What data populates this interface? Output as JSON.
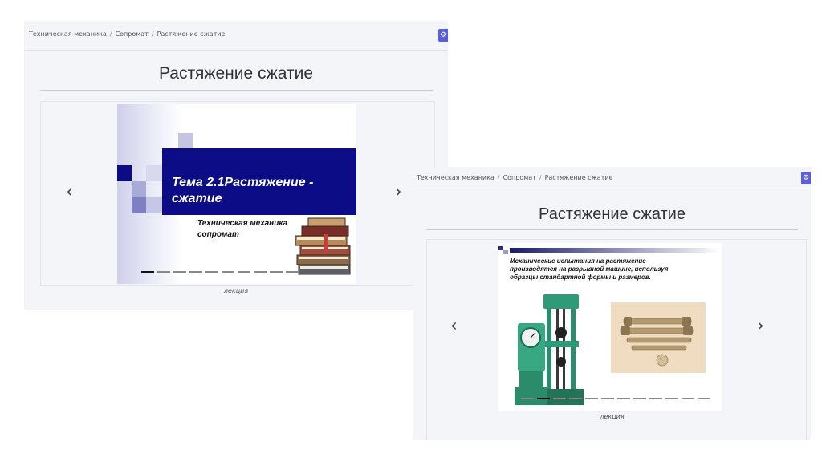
{
  "breadcrumb": {
    "items": [
      "Техническая механика",
      "Сопромат",
      "Растяжение сжатие"
    ],
    "separator": "/"
  },
  "page": {
    "title": "Растяжение сжатие",
    "caption": "лекция",
    "accent_color": "#5b5fd6"
  },
  "icons": {
    "settings": "gear-icon",
    "prev": "chevron-left-icon",
    "next": "chevron-right-icon",
    "slide1_image": "stack-of-books-icon",
    "slide2_machine": "tensile-testing-machine-icon",
    "slide2_specimens": "test-specimens-photo"
  },
  "slide1": {
    "title_line1": "Тема 2.1Растяжение -",
    "title_line2": "сжатие",
    "subtitle_line1": "Техническая механика",
    "subtitle_line2": "сопромат",
    "band_color": "#0c0c86"
  },
  "slide2": {
    "text_line1": "Механические испытания на растяжение",
    "text_line2": "производятся на разрывной машине, используя",
    "text_line3": "образцы стандартной формы и размеров."
  }
}
